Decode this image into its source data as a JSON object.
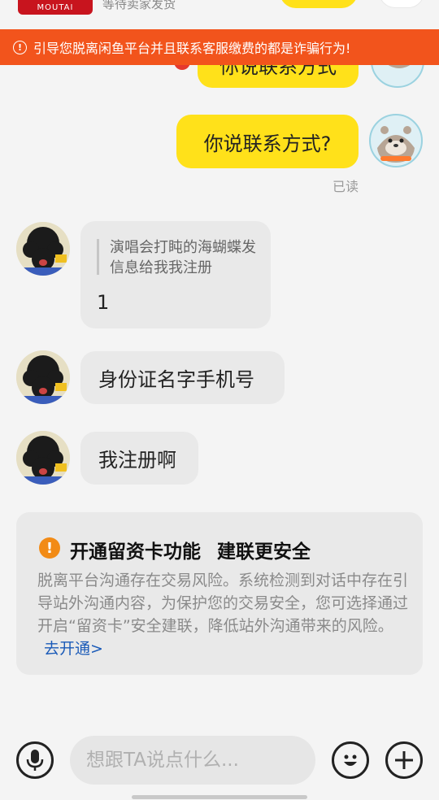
{
  "product": {
    "status_text": "等待卖家发货",
    "thumb_text": "MOUTAI"
  },
  "warning_banner": {
    "text": "引导您脱离闲鱼平台并且联系客服缴费的都是诈骗行为!"
  },
  "messages": {
    "prev_sent": "你说联系方式",
    "sent": "你说联系方式?",
    "read_status": "已读",
    "quote": {
      "quoted_text": "演唱会打盹的海蝴蝶发信息给我我注册",
      "reply_text": "1"
    },
    "received_2": "身份证名字手机号",
    "received_3": "我注册啊"
  },
  "notice": {
    "icon": "exclamation-icon",
    "title_part1": "开通留资卡功能",
    "title_part2": "建联更安全",
    "body": "脱离平台沟通存在交易风险。系统检测到对话中存在引导站外沟通内容，为保护您的交易安全，您可选择通过开启“留资卡”安全建联，降低站外沟通带来的风险。",
    "link": "去开通>"
  },
  "input_bar": {
    "placeholder": "想跟TA说点什么...",
    "voice_icon": "microphone-icon",
    "emoji_icon": "emoji-icon",
    "plus_icon": "plus-icon"
  },
  "colors": {
    "banner": "#f2541c",
    "self_bubble": "#ffe11a",
    "other_bubble": "#e9e9e9",
    "link": "#1a5ab8"
  }
}
